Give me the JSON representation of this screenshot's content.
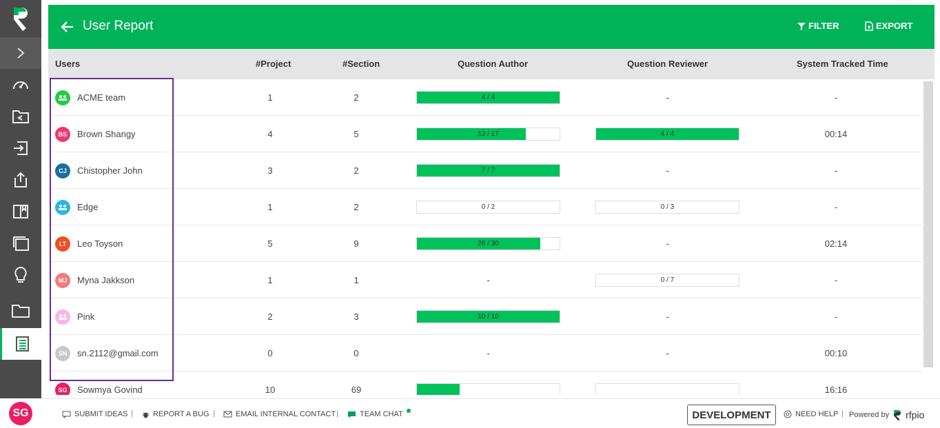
{
  "header": {
    "title": "User Report",
    "filter_label": "FILTER",
    "export_label": "EXPORT"
  },
  "columns": [
    "Users",
    "#Project",
    "#Section",
    "Question Author",
    "Question Reviewer",
    "System Tracked Time"
  ],
  "rows": [
    {
      "initials": "",
      "avatar_color": "#22cc44",
      "name": "ACME team",
      "project": "1",
      "section": "2",
      "author": {
        "text": "4 / 4",
        "fill": 1.0
      },
      "reviewer": {
        "text": "-"
      },
      "time": "-"
    },
    {
      "initials": "BS",
      "avatar_color": "#f0386b",
      "name": "Brown Shangy",
      "project": "4",
      "section": "5",
      "author": {
        "text": "13 / 17",
        "fill": 0.7647
      },
      "reviewer": {
        "text": "4 / 4",
        "fill": 1.0
      },
      "time": "00:14"
    },
    {
      "initials": "CJ",
      "avatar_color": "#1a6fa0",
      "name": "Chistopher John",
      "project": "3",
      "section": "2",
      "author": {
        "text": "7 / 7",
        "fill": 1.0
      },
      "reviewer": {
        "text": "-"
      },
      "time": "-"
    },
    {
      "initials": "",
      "avatar_color": "#29b6e6",
      "name": "Edge",
      "project": "1",
      "section": "2",
      "author": {
        "text": "0 / 2",
        "fill": 0
      },
      "reviewer": {
        "text": "0 / 3",
        "fill": 0
      },
      "time": "-"
    },
    {
      "initials": "LT",
      "avatar_color": "#f04e23",
      "name": "Leo Toyson",
      "project": "5",
      "section": "9",
      "author": {
        "text": "26 / 30",
        "fill": 0.8667
      },
      "reviewer": {
        "text": "-"
      },
      "time": "02:14"
    },
    {
      "initials": "MJ",
      "avatar_color": "#f27b7b",
      "name": "Myna Jakkson",
      "project": "1",
      "section": "1",
      "author": {
        "text": "-"
      },
      "reviewer": {
        "text": "0 / 7",
        "fill": 0
      },
      "time": "-"
    },
    {
      "initials": "",
      "avatar_color": "#f7b6e8",
      "name": "Pink",
      "project": "2",
      "section": "3",
      "author": {
        "text": "10 / 10",
        "fill": 1.0
      },
      "reviewer": {
        "text": "-"
      },
      "time": "-"
    },
    {
      "initials": "SN",
      "avatar_color": "#c8c8c8",
      "name": "sn.2112@gmail.com",
      "project": "0",
      "section": "0",
      "author": {
        "text": "-"
      },
      "reviewer": {
        "text": "-"
      },
      "time": "00:10"
    },
    {
      "initials": "SG",
      "avatar_color": "#e91e63",
      "name": "Sowmya Govind",
      "project": "10",
      "section": "69",
      "author": {
        "text": "",
        "fill": 0.3
      },
      "reviewer": {
        "text": "",
        "fill": 0
      },
      "time": "16:16"
    }
  ],
  "footer": {
    "submit_ideas": "SUBMIT IDEAS",
    "report_bug": "REPORT A BUG",
    "email_contact": "EMAIL INTERNAL CONTACT",
    "team_chat": "TEAM CHAT",
    "environment": "DEVELOPMENT",
    "need_help": "NEED HELP",
    "powered_by": "Powered by",
    "brand": "rfpio"
  },
  "user_avatar": "SG",
  "colors": {
    "accent": "#00b359",
    "bar": "#00c15a",
    "sidebar": "#4a4a4a",
    "highlight": "#6b2c91"
  }
}
